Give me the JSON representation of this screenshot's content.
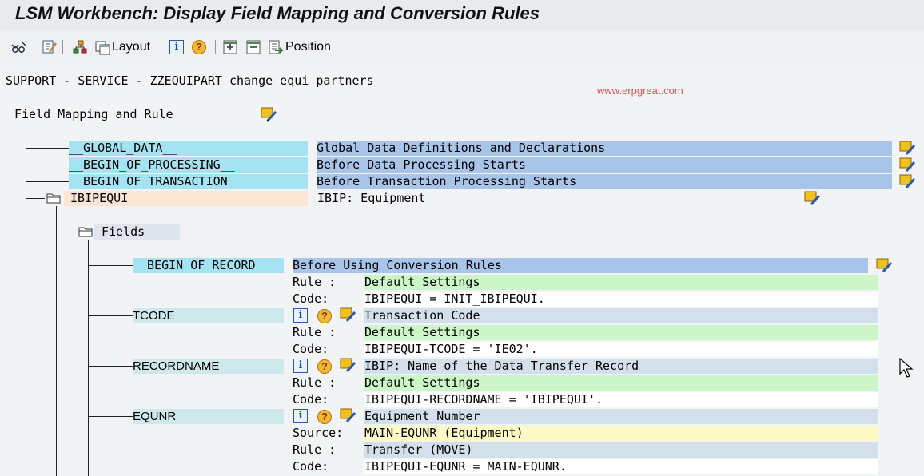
{
  "window": {
    "title": "LSM Workbench: Display Field Mapping and Conversion Rules"
  },
  "toolbar": {
    "layout_label": "Layout",
    "position_label": "Position",
    "icons": [
      "glasses-icon",
      "edit-icon",
      "hierarchy-icon",
      "layout-icon",
      "info-icon",
      "help-icon",
      "expand-icon",
      "collapse-icon",
      "position-icon"
    ]
  },
  "header": {
    "project_line": "SUPPORT - SERVICE - ZZEQUIPART change equi partners",
    "watermark": "www.erpgreat.com",
    "tree_root": "Field Mapping and Rule"
  },
  "top_nodes": [
    {
      "name": "__GLOBAL_DATA__",
      "desc": "Global Data Definitions and Declarations"
    },
    {
      "name": "__BEGIN_OF_PROCESSING__",
      "desc": "Before Data Processing Starts"
    },
    {
      "name": "__BEGIN_OF_TRANSACTION__",
      "desc": "Before Transaction Processing Starts"
    }
  ],
  "structure": {
    "name": "IBIPEQUI",
    "desc": "IBIP: Equipment"
  },
  "fields_folder": "Fields",
  "begin_record": {
    "name": "__BEGIN_OF_RECORD__",
    "desc": "Before Using Conversion Rules",
    "rule_label": "Rule :",
    "rule": "Default Settings",
    "code_label": "Code:",
    "code": "IBIPEQUI = INIT_IBIPEQUI."
  },
  "fields": [
    {
      "name": "TCODE",
      "desc": "Transaction Code",
      "rule_label": "Rule :",
      "rule": "Default Settings",
      "code_label": "Code:",
      "code": "IBIPEQUI-TCODE = 'IE02'."
    },
    {
      "name": "RECORDNAME",
      "desc": "IBIP: Name of the Data Transfer Record",
      "rule_label": "Rule :",
      "rule": "Default Settings",
      "code_label": "Code:",
      "code": "IBIPEQUI-RECORDNAME = 'IBIPEQUI'."
    },
    {
      "name": "EQUNR",
      "desc": "Equipment Number",
      "source_label": "Source:",
      "source": "MAIN-EQUNR (Equipment)",
      "rule_label": "Rule :",
      "rule": "Transfer (MOVE)",
      "code_label": "Code:",
      "code": "IBIPEQUI-EQUNR = MAIN-EQUNR."
    }
  ]
}
